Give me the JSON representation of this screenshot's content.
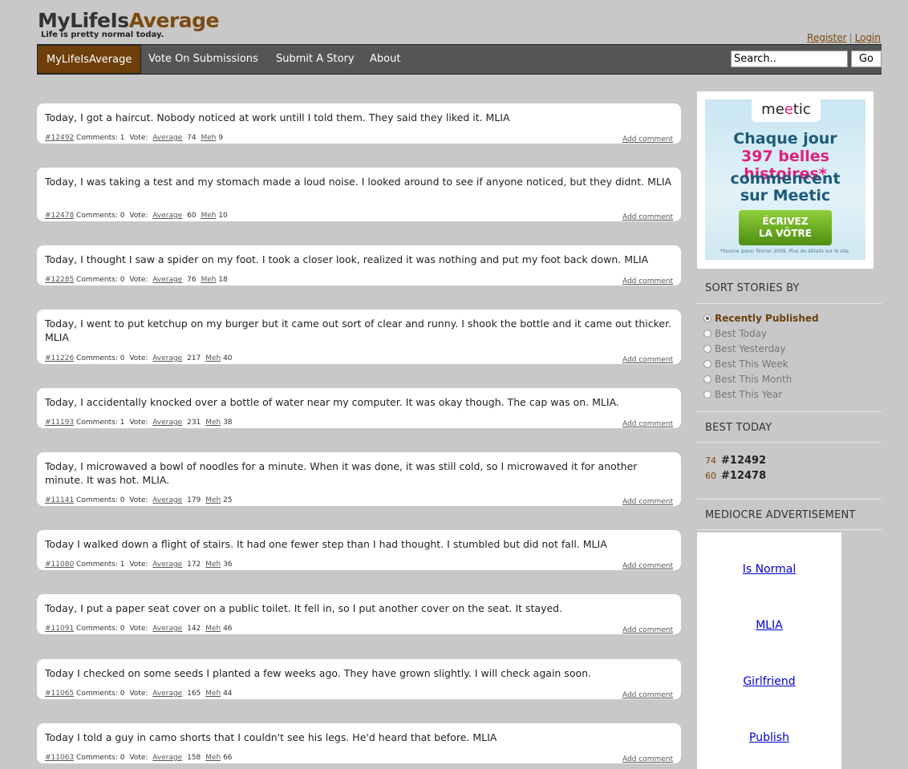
{
  "logo": {
    "part1": "MyLifeIs",
    "part2": "Average",
    "tagline": "Life is pretty normal today."
  },
  "auth": {
    "register": "Register",
    "separator": "|",
    "login": "Login"
  },
  "nav": {
    "items": [
      "MyLifeIsAverage",
      "Vote On Submissions",
      "Submit A Story",
      "About"
    ],
    "search_value": "Search..",
    "go": "Go"
  },
  "stories": [
    {
      "text": "Today, I got a haircut. Nobody noticed at work untill I told them. They said they liked it. MLIA",
      "id": "#12492",
      "comments": "Comments: 1",
      "vote": "Vote:",
      "average": "Average",
      "avg_count": "74",
      "meh": "Meh",
      "meh_count": "9"
    },
    {
      "text": "Today, I was taking a test and my stomach made a loud noise. I looked around to see if anyone noticed, but they didnt. MLIA",
      "id": "#12478",
      "comments": "Comments: 0",
      "vote": "Vote:",
      "average": "Average",
      "avg_count": "60",
      "meh": "Meh",
      "meh_count": "10"
    },
    {
      "text": "Today, I thought I saw a spider on my foot. I took a closer look, realized it was nothing and put my foot back down. MLIA",
      "id": "#12285",
      "comments": "Comments: 0",
      "vote": "Vote:",
      "average": "Average",
      "avg_count": "76",
      "meh": "Meh",
      "meh_count": "18"
    },
    {
      "text": "Today, I went to put ketchup on my burger but it came out sort of clear and runny. I shook the bottle and it came out thicker. MLIA",
      "id": "#11226",
      "comments": "Comments: 0",
      "vote": "Vote:",
      "average": "Average",
      "avg_count": "217",
      "meh": "Meh",
      "meh_count": "40"
    },
    {
      "text": "Today, I accidentally knocked over a bottle of water near my computer. It was okay though. The cap was on. MLIA.",
      "id": "#11193",
      "comments": "Comments: 1",
      "vote": "Vote:",
      "average": "Average",
      "avg_count": "231",
      "meh": "Meh",
      "meh_count": "38"
    },
    {
      "text": "Today, I microwaved a bowl of noodles for a minute. When it was done, it was still cold, so I microwaved it for another minute. It was hot. MLIA.",
      "id": "#11141",
      "comments": "Comments: 0",
      "vote": "Vote:",
      "average": "Average",
      "avg_count": "179",
      "meh": "Meh",
      "meh_count": "25"
    },
    {
      "text": "Today I walked down a flight of stairs. It had one fewer step than I had thought. I stumbled but did not fall. MLIA",
      "id": "#11080",
      "comments": "Comments: 1",
      "vote": "Vote:",
      "average": "Average",
      "avg_count": "172",
      "meh": "Meh",
      "meh_count": "36"
    },
    {
      "text": "Today, I put a paper seat cover on a public toilet. It fell in, so I put another cover on the seat. It stayed.",
      "id": "#11091",
      "comments": "Comments: 0",
      "vote": "Vote:",
      "average": "Average",
      "avg_count": "142",
      "meh": "Meh",
      "meh_count": "46"
    },
    {
      "text": "Today I checked on some seeds I planted a few weeks ago. They have grown slightly. I will check again soon.",
      "id": "#11065",
      "comments": "Comments: 0",
      "vote": "Vote:",
      "average": "Average",
      "avg_count": "165",
      "meh": "Meh",
      "meh_count": "44"
    },
    {
      "text": "Today I told a guy in camo shorts that I couldn't see his legs. He'd heard that before. MLIA",
      "id": "#11063",
      "comments": "Comments: 0",
      "vote": "Vote:",
      "average": "Average",
      "avg_count": "158",
      "meh": "Meh",
      "meh_count": "66"
    }
  ],
  "add_comment": "Add comment",
  "ad": {
    "brand_a": "me",
    "brand_e": "e",
    "brand_b": "tic",
    "line1": "Chaque jour",
    "line2": "397 belles histoires*",
    "line3": "commencent",
    "line4": "sur Meetic",
    "cta1": "ÉCRIVEZ",
    "cta2": "LA VÔTRE",
    "note": "*Source Ipsos: février 2009. Plus de détails sur le site."
  },
  "sort": {
    "heading": "SORT STORIES BY",
    "options": [
      "Recently Published",
      "Best Today",
      "Best Yesterday",
      "Best This Week",
      "Best This Month",
      "Best This Year"
    ],
    "selected": 0
  },
  "best_today": {
    "heading": "BEST TODAY",
    "rows": [
      {
        "score": "74",
        "id": "#12492"
      },
      {
        "score": "60",
        "id": "#12478"
      }
    ]
  },
  "mediocre": {
    "heading": "MEDIOCRE ADVERTISEMENT",
    "links": [
      "Is Normal",
      "MLIA",
      "Girlfriend",
      "Publish"
    ]
  }
}
